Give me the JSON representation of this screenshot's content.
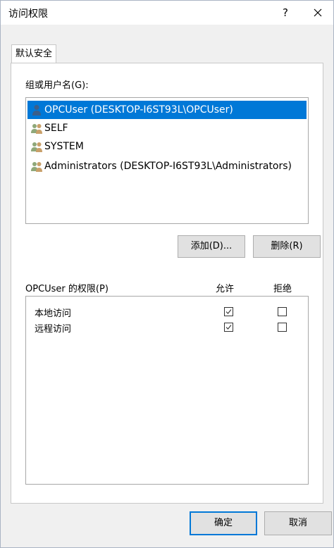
{
  "window": {
    "title": "访问权限",
    "help_label": "?",
    "close_label": "X"
  },
  "tabs": [
    {
      "label": "默认安全",
      "active": true
    }
  ],
  "users": {
    "label": "组或用户名(G):",
    "items": [
      {
        "name": "OPCUser (DESKTOP-I6ST93L\\OPCUser)",
        "icon": "single-user-icon",
        "selected": true
      },
      {
        "name": "SELF",
        "icon": "user-group-icon",
        "selected": false
      },
      {
        "name": "SYSTEM",
        "icon": "user-group-icon",
        "selected": false
      },
      {
        "name": "Administrators (DESKTOP-I6ST93L\\Administrators)",
        "icon": "user-group-icon",
        "selected": false
      }
    ],
    "add_button": "添加(D)...",
    "remove_button": "删除(R)"
  },
  "permissions": {
    "label": "OPCUser 的权限(P)",
    "allow_header": "允许",
    "deny_header": "拒绝",
    "rows": [
      {
        "name": "本地访问",
        "allow": true,
        "deny": false
      },
      {
        "name": "远程访问",
        "allow": true,
        "deny": false
      }
    ]
  },
  "footer": {
    "ok_button": "确定",
    "cancel_button": "取消"
  },
  "colors": {
    "selection": "#0078d7",
    "dialog_bg": "#f0f0f0",
    "button_bg": "#e1e1e1"
  }
}
